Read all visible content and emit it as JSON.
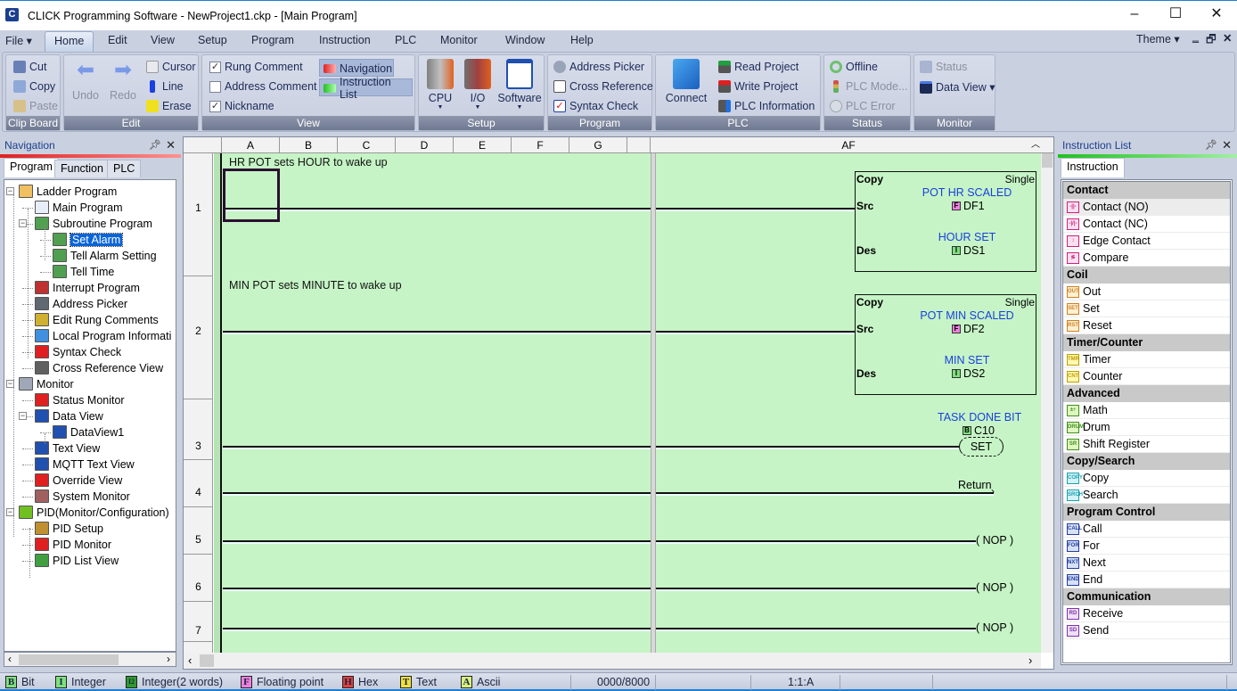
{
  "window": {
    "title": "CLICK Programming Software  - NewProject1.ckp - [Main Program]",
    "minimize": "–",
    "maximize": "☐",
    "close": "✕"
  },
  "menu": {
    "items": [
      "File ▾",
      "Home",
      "Edit",
      "View",
      "Setup",
      "Program",
      "Instruction",
      "PLC",
      "Monitor",
      "Window",
      "Help"
    ],
    "active": "Home",
    "theme": "Theme ▾",
    "mdi_controls": [
      "‗",
      "🗗",
      "✕"
    ]
  },
  "ribbon": {
    "clipboard": {
      "title": "Clip Board",
      "cut": "Cut",
      "copy": "Copy",
      "paste": "Paste"
    },
    "edit": {
      "title": "Edit",
      "undo": "Undo",
      "redo": "Redo",
      "cursor": "Cursor",
      "line": "Line",
      "erase": "Erase"
    },
    "view": {
      "title": "View",
      "rung_comment": {
        "label": "Rung Comment",
        "checked": true
      },
      "address_comment": {
        "label": "Address Comment",
        "checked": false
      },
      "nickname": {
        "label": "Nickname",
        "checked": true
      },
      "navigation": "Navigation",
      "instruction_list": "Instruction List"
    },
    "setup": {
      "title": "Setup",
      "cpu": "CPU",
      "io": "I/O",
      "software": "Software"
    },
    "program": {
      "title": "Program",
      "address_picker": "Address Picker",
      "cross_reference": "Cross Reference",
      "syntax_check": "Syntax Check"
    },
    "plc": {
      "title": "PLC",
      "connect": "Connect",
      "read_project": "Read Project",
      "write_project": "Write Project",
      "plc_information": "PLC Information"
    },
    "status": {
      "title": "Status",
      "offline": "Offline",
      "plc_mode": "PLC Mode...",
      "plc_error": "PLC Error"
    },
    "monitor": {
      "title": "Monitor",
      "status": "Status",
      "data_view": "Data View ▾"
    }
  },
  "navigation": {
    "title": "Navigation",
    "tabs": [
      "Program",
      "Function",
      "PLC"
    ],
    "tree": [
      {
        "label": "Ladder Program",
        "level": 0,
        "expanded": true
      },
      {
        "label": "Main Program",
        "level": 1
      },
      {
        "label": "Subroutine Program",
        "level": 1,
        "expanded": true
      },
      {
        "label": "Set Alarm",
        "level": 2,
        "selected": true
      },
      {
        "label": "Tell Alarm Setting",
        "level": 2
      },
      {
        "label": "Tell Time",
        "level": 2
      },
      {
        "label": "Interrupt Program",
        "level": 1
      },
      {
        "label": "Address Picker",
        "level": 1
      },
      {
        "label": "Edit Rung Comments",
        "level": 1
      },
      {
        "label": "Local Program Informati",
        "level": 1
      },
      {
        "label": "Syntax Check",
        "level": 1
      },
      {
        "label": "Cross Reference View",
        "level": 1
      },
      {
        "label": "Monitor",
        "level": 0,
        "expanded": true
      },
      {
        "label": "Status Monitor",
        "level": 1
      },
      {
        "label": "Data View",
        "level": 1,
        "expanded": true
      },
      {
        "label": "DataView1",
        "level": 2
      },
      {
        "label": "Text View",
        "level": 1
      },
      {
        "label": "MQTT Text View",
        "level": 1
      },
      {
        "label": "Override View",
        "level": 1
      },
      {
        "label": "System Monitor",
        "level": 1
      },
      {
        "label": "PID(Monitor/Configuration)",
        "level": 0,
        "expanded": true
      },
      {
        "label": "PID Setup",
        "level": 1
      },
      {
        "label": "PID Monitor",
        "level": 1
      },
      {
        "label": "PID List View",
        "level": 1
      }
    ]
  },
  "ladder": {
    "columns": [
      "A",
      "B",
      "C",
      "D",
      "E",
      "F",
      "G",
      "AF"
    ],
    "rungs": [
      {
        "number": "1",
        "comment": "HR POT sets HOUR to wake up",
        "instruction": {
          "type": "Copy",
          "mode": "Single",
          "src_label": "Src",
          "des_label": "Des",
          "src_nickname": "POT HR SCALED",
          "src_type": "F",
          "src_addr": "DF1",
          "des_nickname": "HOUR SET",
          "des_type": "I",
          "des_addr": "DS1"
        }
      },
      {
        "number": "2",
        "comment": "MIN POT sets MINUTE to wake up",
        "instruction": {
          "type": "Copy",
          "mode": "Single",
          "src_label": "Src",
          "des_label": "Des",
          "src_nickname": "POT MIN SCALED",
          "src_type": "F",
          "src_addr": "DF2",
          "des_nickname": "MIN SET",
          "des_type": "I",
          "des_addr": "DS2"
        }
      },
      {
        "number": "3",
        "coil": {
          "nickname": "TASK DONE BIT",
          "type": "B",
          "addr": "C10",
          "label": "SET"
        }
      },
      {
        "number": "4",
        "coil": {
          "label": "Return"
        }
      },
      {
        "number": "5",
        "coil": {
          "label": "( NOP )"
        }
      },
      {
        "number": "6",
        "coil": {
          "label": "( NOP )"
        }
      },
      {
        "number": "7",
        "coil": {
          "label": "( NOP )"
        }
      }
    ]
  },
  "instruction_list": {
    "title": "Instruction List",
    "tab": "Instruction",
    "categories": [
      {
        "name": "Contact",
        "items": [
          {
            "label": "Contact (NO)",
            "icon": "-||-"
          },
          {
            "label": "Contact (NC)",
            "icon": "-|/|-"
          },
          {
            "label": "Edge Contact",
            "icon": "↕"
          },
          {
            "label": "Compare",
            "icon": "≶"
          }
        ]
      },
      {
        "name": "Coil",
        "items": [
          {
            "label": "Out",
            "icon": "OUT"
          },
          {
            "label": "Set",
            "icon": "SET"
          },
          {
            "label": "Reset",
            "icon": "RST"
          }
        ]
      },
      {
        "name": "Timer/Counter",
        "items": [
          {
            "label": "Timer",
            "icon": "TMR"
          },
          {
            "label": "Counter",
            "icon": "CNT"
          }
        ]
      },
      {
        "name": "Advanced",
        "items": [
          {
            "label": "Math",
            "icon": "±÷"
          },
          {
            "label": "Drum",
            "icon": "DRUM"
          },
          {
            "label": "Shift Register",
            "icon": "SR"
          }
        ]
      },
      {
        "name": "Copy/Search",
        "items": [
          {
            "label": "Copy",
            "icon": "COPY"
          },
          {
            "label": "Search",
            "icon": "SRCH"
          }
        ]
      },
      {
        "name": "Program Control",
        "items": [
          {
            "label": "Call",
            "icon": "CALL"
          },
          {
            "label": "For",
            "icon": "FOR"
          },
          {
            "label": "Next",
            "icon": "NXT"
          },
          {
            "label": "End",
            "icon": "END"
          }
        ]
      },
      {
        "name": "Communication",
        "items": [
          {
            "label": "Receive",
            "icon": "RD"
          },
          {
            "label": "Send",
            "icon": "SD"
          }
        ]
      }
    ]
  },
  "statusbar": {
    "legend": [
      {
        "glyph": "B",
        "label": "Bit",
        "color": "#7fe07f"
      },
      {
        "glyph": "I",
        "label": "Integer",
        "color": "#7fe07f"
      },
      {
        "glyph": "I2",
        "label": "Integer(2 words)",
        "color": "#2f9a2f"
      },
      {
        "glyph": "F",
        "label": "Floating point",
        "color": "#f080e0"
      },
      {
        "glyph": "H",
        "label": "Hex",
        "color": "#e04040"
      },
      {
        "glyph": "T",
        "label": "Text",
        "color": "#f0e040"
      },
      {
        "glyph": "A",
        "label": "Ascii",
        "color": "#d8f080"
      }
    ],
    "memory": "0000/8000",
    "position": "1:1:A"
  },
  "colors": {
    "ladder_bg": "#c6f4c6",
    "nickname": "#1a3fe0",
    "selection": "#0a64d6",
    "ribbon_bg": "#c9d0df",
    "accent": "#1e7fd4"
  }
}
